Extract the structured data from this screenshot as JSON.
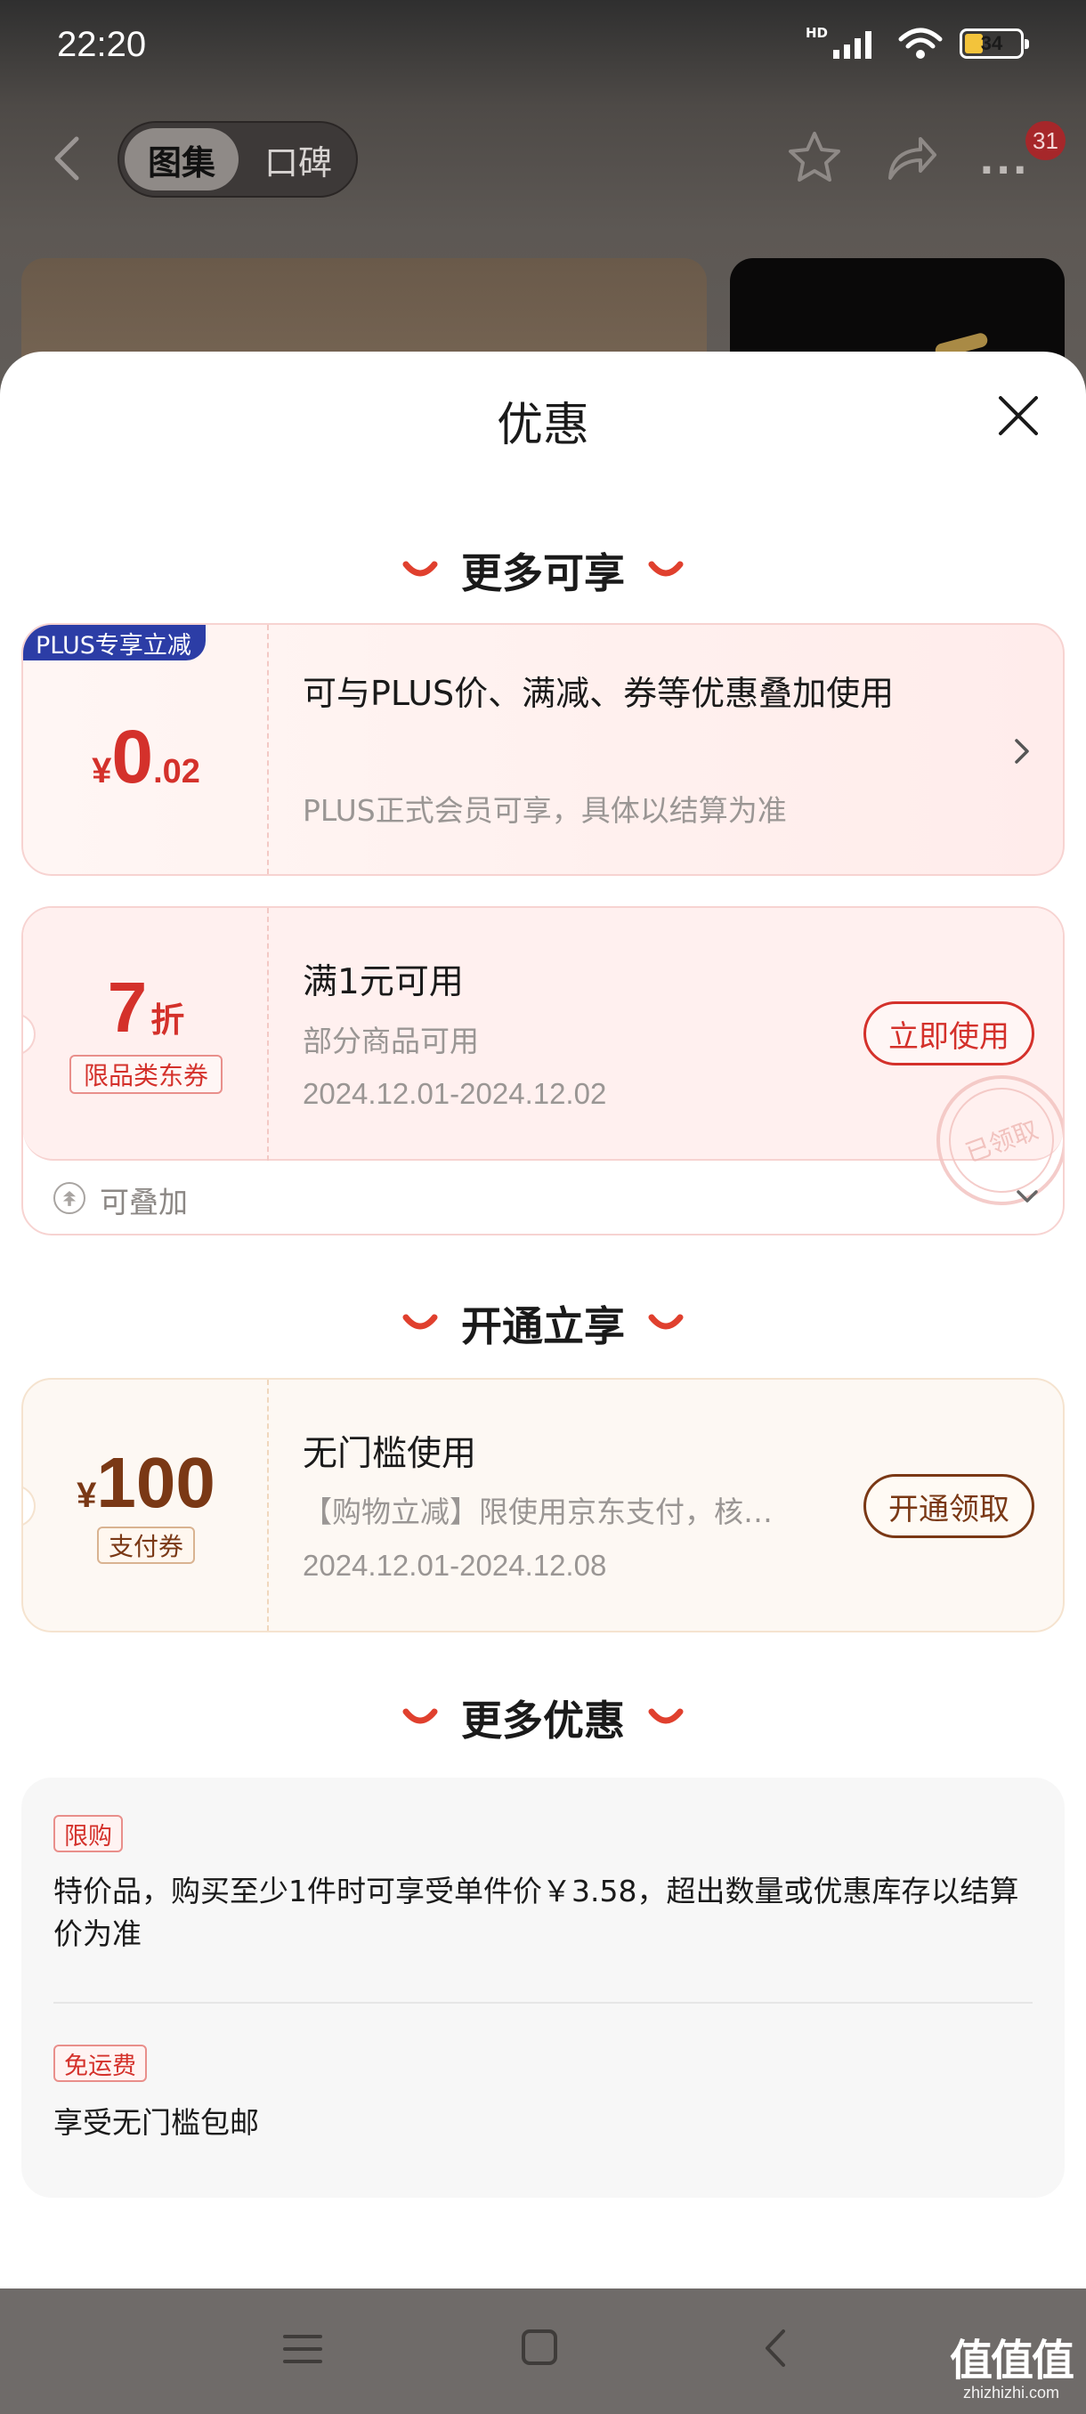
{
  "status_bar": {
    "time": "22:20",
    "network_label": "HD",
    "battery_level": "34",
    "battery_fraction": 0.34
  },
  "top_nav": {
    "tabs": [
      "图集",
      "口碑"
    ],
    "active_tab": "图集",
    "notification_count": "31",
    "icons": [
      "back-chevron-icon",
      "star-icon",
      "share-icon",
      "more-dots-icon"
    ]
  },
  "sheet": {
    "title": "优惠",
    "close_icon": "close-x-icon"
  },
  "section_more_available": {
    "title": "更多可享"
  },
  "plus_card": {
    "tag": "PLUS专享立减",
    "currency": "¥",
    "amount_int": "0",
    "amount_dec": ".02",
    "title": "可与PLUS价、满减、券等优惠叠加使用",
    "subtitle": "PLUS正式会员可享，具体以结算为准"
  },
  "coupon_card": {
    "discount_value": "7",
    "discount_unit": "折",
    "coupon_type": "限品类东券",
    "title": "满1元可用",
    "description": "部分商品可用",
    "validity": "2024.12.01-2024.12.02",
    "action_label": "立即使用",
    "stamp_text": "已领取",
    "stack_label": "可叠加"
  },
  "section_open": {
    "title": "开通立享"
  },
  "pay_card": {
    "currency": "¥",
    "amount": "100",
    "coupon_type": "支付券",
    "title": "无门槛使用",
    "description": "【购物立减】限使用京东支付，核…",
    "validity": "2024.12.01-2024.12.08",
    "action_label": "开通领取"
  },
  "section_more_offers": {
    "title": "更多优惠"
  },
  "offers": [
    {
      "tag": "限购",
      "text": "特价品，购买至少1件时可享受单件价￥3.58，超出数量或优惠库存以结算价为准"
    },
    {
      "tag": "免运费",
      "text": "享受无门槛包邮"
    }
  ],
  "system_nav": {
    "icons": [
      "menu-icon",
      "home-square-icon",
      "back-triangle-icon"
    ]
  },
  "watermark": {
    "main": "值值值",
    "sub": "zhizhizhi.com"
  },
  "colors": {
    "accent_red": "#d4312b",
    "plus_blue": "#2c3da6",
    "brown": "#7a3815"
  }
}
